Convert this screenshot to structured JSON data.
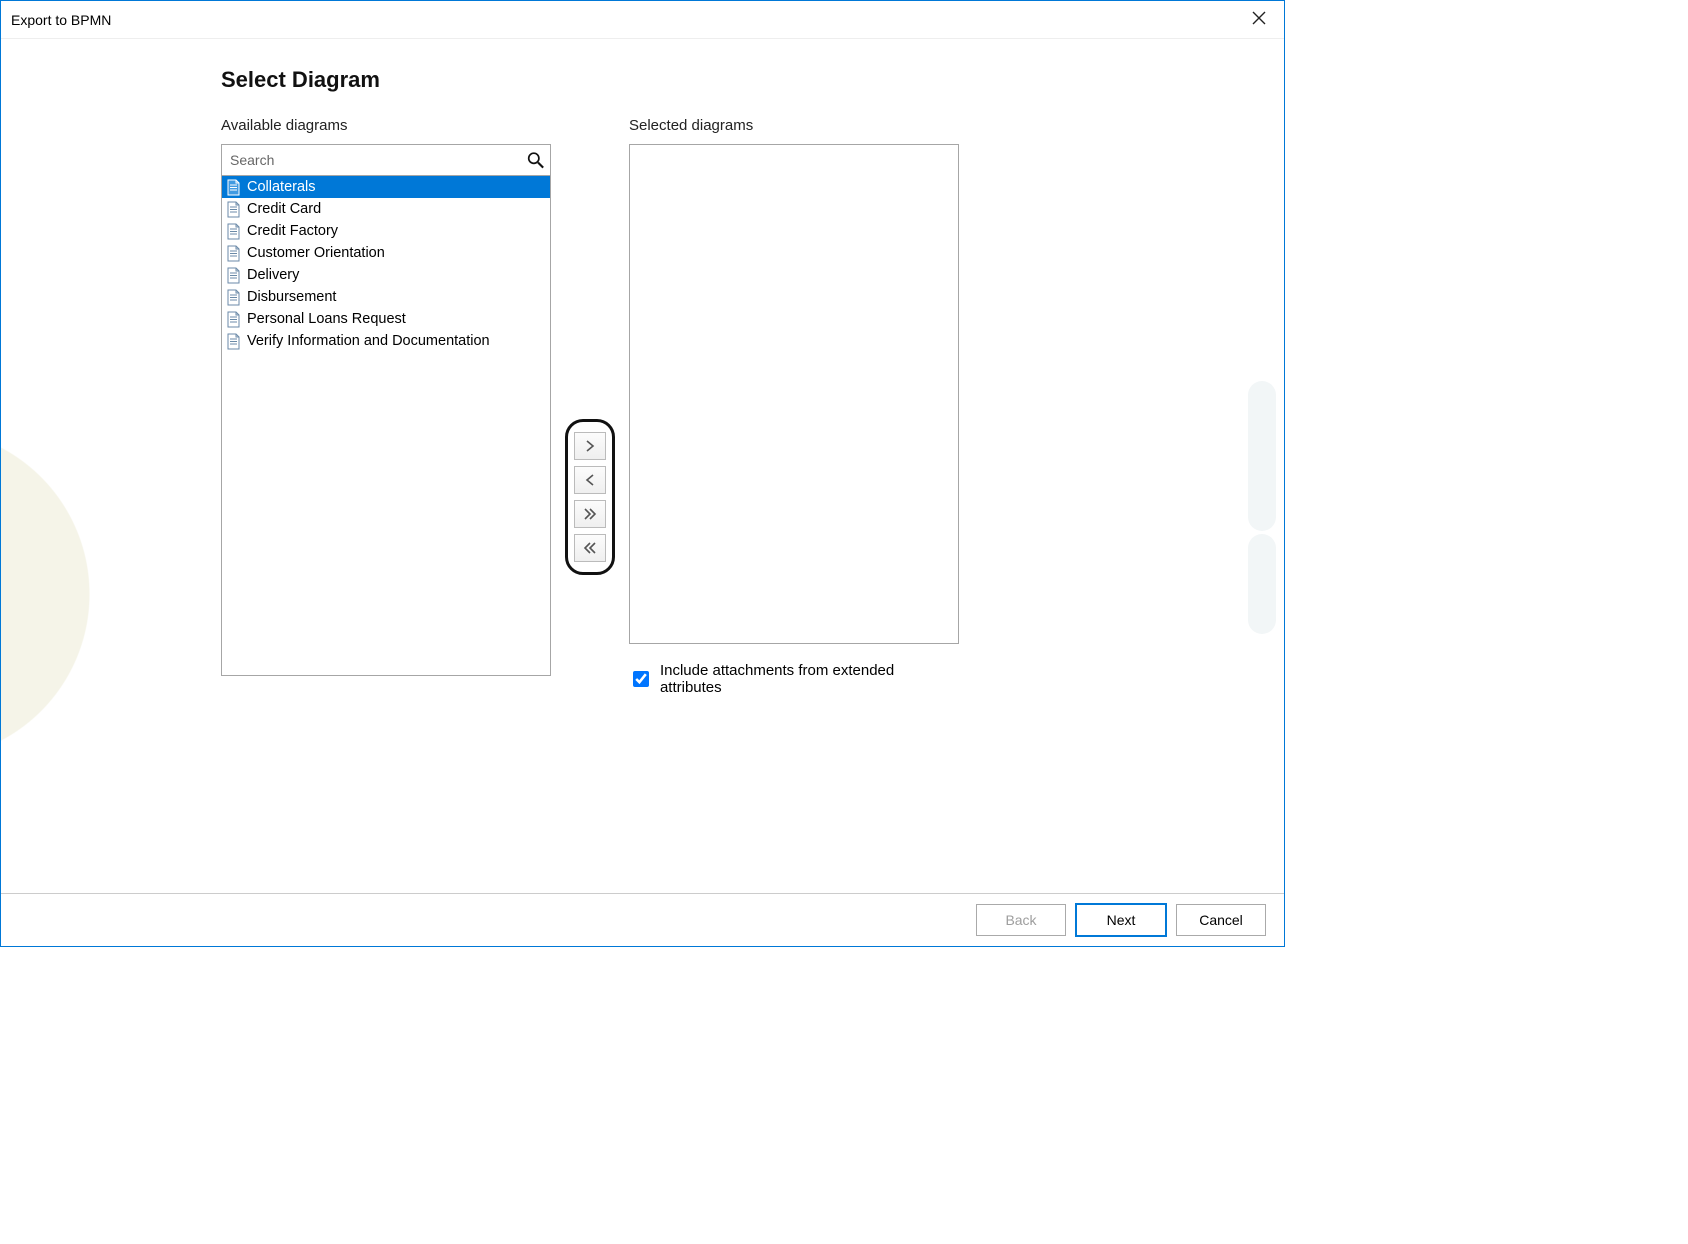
{
  "window_title": "Export to BPMN",
  "heading": "Select Diagram",
  "available": {
    "label": "Available diagrams",
    "search_placeholder": "Search",
    "items": [
      "Collaterals",
      "Credit Card",
      "Credit Factory",
      "Customer Orientation",
      "Delivery",
      "Disbursement",
      "Personal Loans Request",
      "Verify Information and Documentation"
    ],
    "selected_index": 0
  },
  "selected": {
    "label": "Selected diagrams",
    "items": []
  },
  "include_attachments_label": "Include attachments from extended attributes",
  "include_attachments_checked": true,
  "buttons": {
    "back": "Back",
    "next": "Next",
    "cancel": "Cancel"
  }
}
